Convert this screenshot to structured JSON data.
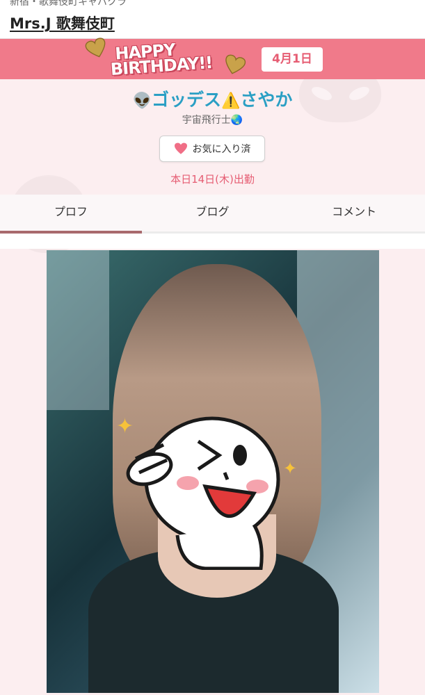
{
  "header": {
    "breadcrumb": "新宿・歌舞伎町キャバクラ",
    "site_title": "Mrs.J 歌舞伎町"
  },
  "banner": {
    "text_line1": "HAPPY",
    "text_line2": "BIRTHDAY!!",
    "date": "4月1日",
    "colors": {
      "background": "#f07a8a",
      "date_text": "#e65d73"
    }
  },
  "profile": {
    "name_prefix_icon": "👽",
    "name_part1": "ゴッデス",
    "name_warning_icon": "⚠️",
    "name_part2": "さやか",
    "subtitle": "宇宙飛行士🌏",
    "favorite_button": {
      "icon": "heart-icon",
      "label": "お気に入り済"
    },
    "shift": "本日14日(木)出勤"
  },
  "tabs": [
    {
      "label": "プロフ",
      "active": true
    },
    {
      "label": "ブログ",
      "active": false
    },
    {
      "label": "コメント",
      "active": false
    }
  ],
  "colors": {
    "accent": "#e65d73",
    "name": "#2a9fc4",
    "tab_indicator": "#a86a6d",
    "page_background": "#fceef0"
  }
}
